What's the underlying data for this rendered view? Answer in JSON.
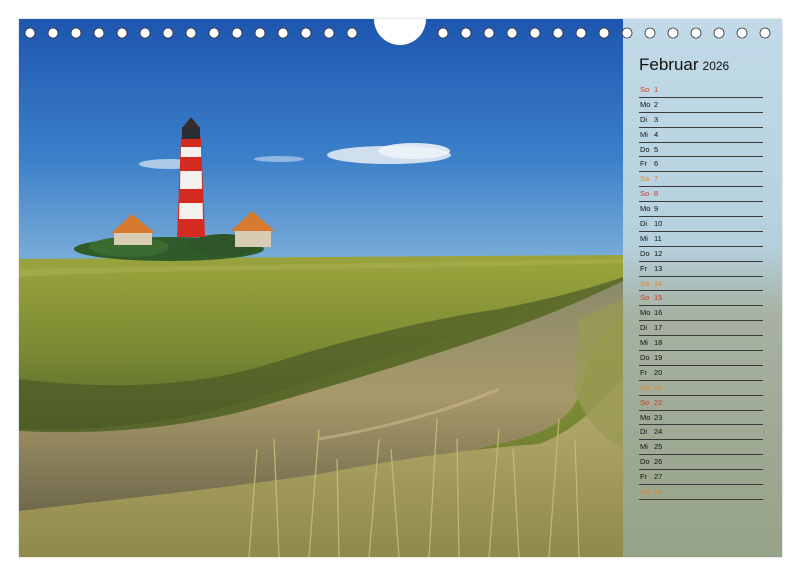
{
  "calendar": {
    "month": "Februar",
    "year": "2026",
    "colors": {
      "sunday": "#d8341d",
      "saturday": "#e0872a",
      "weekday": "#111111"
    },
    "days": [
      {
        "dn": "So",
        "num": "1",
        "type": "sun"
      },
      {
        "dn": "Mo",
        "num": "2",
        "type": "wd"
      },
      {
        "dn": "Di",
        "num": "3",
        "type": "wd"
      },
      {
        "dn": "Mi",
        "num": "4",
        "type": "wd"
      },
      {
        "dn": "Do",
        "num": "5",
        "type": "wd"
      },
      {
        "dn": "Fr",
        "num": "6",
        "type": "wd"
      },
      {
        "dn": "Sa",
        "num": "7",
        "type": "sat"
      },
      {
        "dn": "So",
        "num": "8",
        "type": "sun"
      },
      {
        "dn": "Mo",
        "num": "9",
        "type": "wd"
      },
      {
        "dn": "Di",
        "num": "10",
        "type": "wd"
      },
      {
        "dn": "Mi",
        "num": "11",
        "type": "wd"
      },
      {
        "dn": "Do",
        "num": "12",
        "type": "wd"
      },
      {
        "dn": "Fr",
        "num": "13",
        "type": "wd"
      },
      {
        "dn": "Sa",
        "num": "14",
        "type": "sat"
      },
      {
        "dn": "So",
        "num": "15",
        "type": "sun"
      },
      {
        "dn": "Mo",
        "num": "16",
        "type": "wd"
      },
      {
        "dn": "Di",
        "num": "17",
        "type": "wd"
      },
      {
        "dn": "Mi",
        "num": "18",
        "type": "wd"
      },
      {
        "dn": "Do",
        "num": "19",
        "type": "wd"
      },
      {
        "dn": "Fr",
        "num": "20",
        "type": "wd"
      },
      {
        "dn": "Sa",
        "num": "21",
        "type": "sat"
      },
      {
        "dn": "So",
        "num": "22",
        "type": "sun"
      },
      {
        "dn": "Mo",
        "num": "23",
        "type": "wd"
      },
      {
        "dn": "Di",
        "num": "24",
        "type": "wd"
      },
      {
        "dn": "Mi",
        "num": "25",
        "type": "wd"
      },
      {
        "dn": "Do",
        "num": "26",
        "type": "wd"
      },
      {
        "dn": "Fr",
        "num": "27",
        "type": "wd"
      },
      {
        "dn": "Sa",
        "num": "28",
        "type": "sat"
      }
    ]
  },
  "photo": {
    "subject": "lighthouse"
  }
}
